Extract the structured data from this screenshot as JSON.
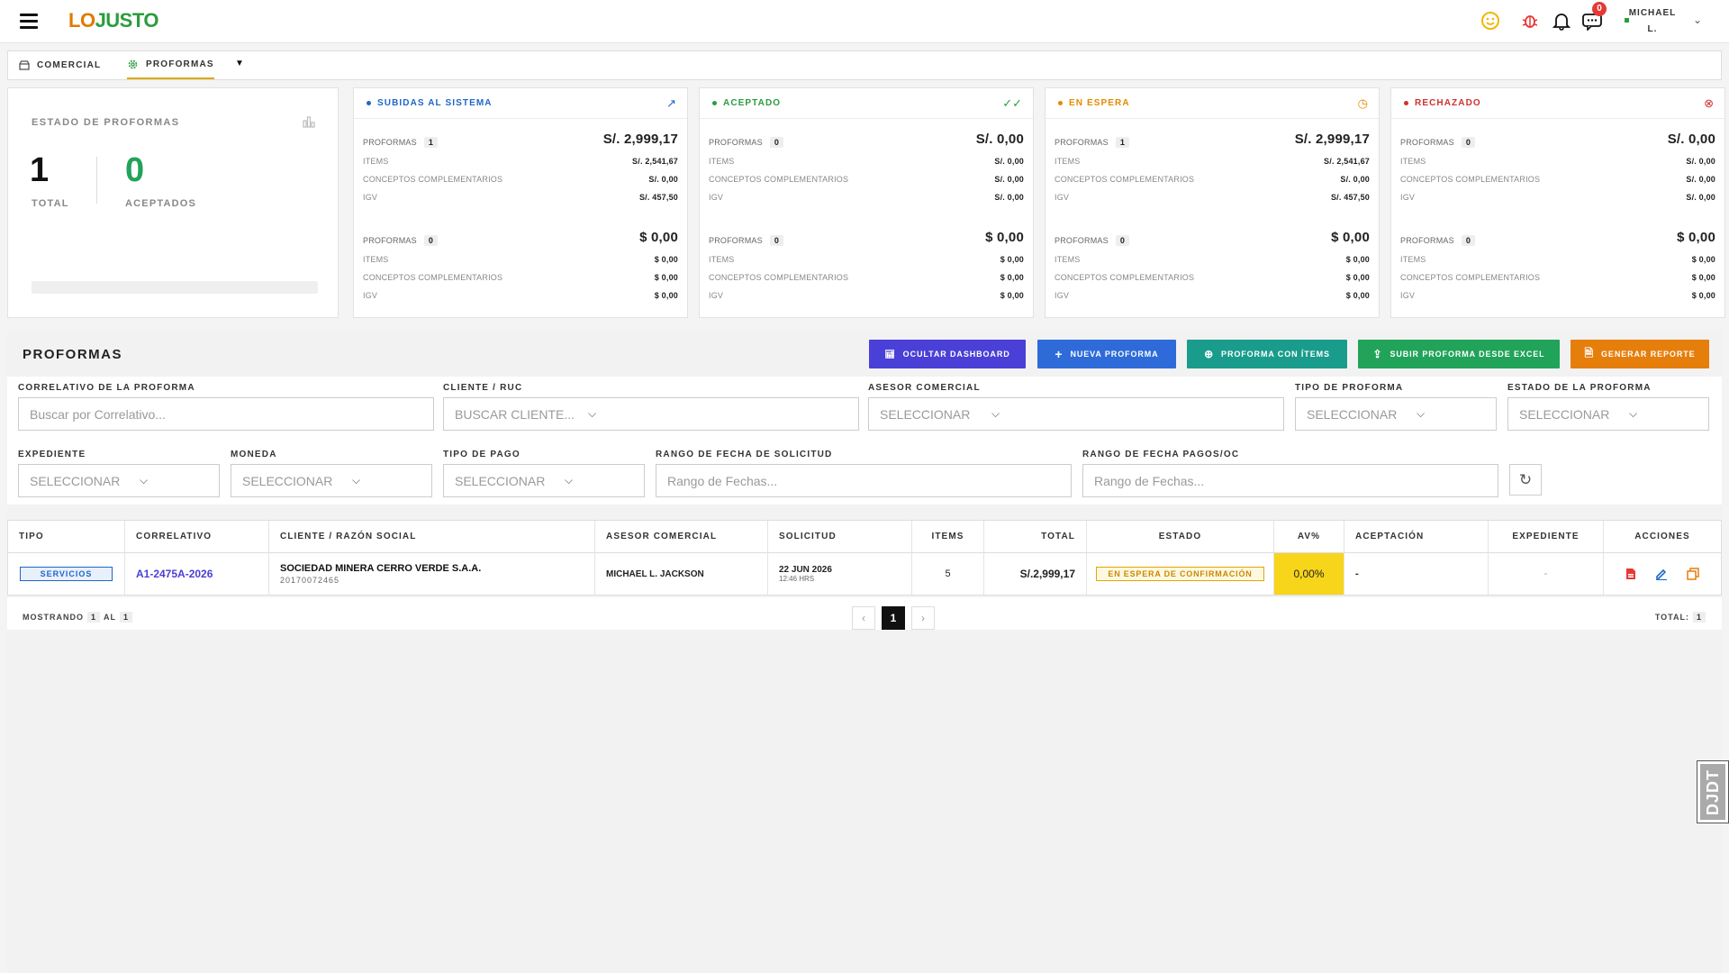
{
  "header": {
    "logo_part1": "LO",
    "logo_part2": "JUSTO",
    "notification_count": "0",
    "user_first": "MICHAEL",
    "user_last": "L."
  },
  "breadcrumb": {
    "item1": "COMERCIAL",
    "item2": "PROFORMAS"
  },
  "summary": {
    "title": "ESTADO DE PROFORMAS",
    "total_value": "1",
    "total_label": "TOTAL",
    "accepted_value": "0",
    "accepted_label": "ACEPTADOS"
  },
  "status_cards": [
    {
      "title": "SUBIDAS AL SISTEMA",
      "color": "#1e66c8",
      "soles": {
        "proformas_label": "PROFORMAS",
        "count": "1",
        "total": "S/. 2,999,17",
        "items_label": "ITEMS",
        "items": "S/. 2,541,67",
        "conceptos_label": "CONCEPTOS COMPLEMENTARIOS",
        "conceptos": "S/. 0,00",
        "igv_label": "IGV",
        "igv": "S/. 457,50"
      },
      "dolares": {
        "proformas_label": "PROFORMAS",
        "count": "0",
        "total": "$ 0,00",
        "items_label": "ITEMS",
        "items": "$ 0,00",
        "conceptos_label": "CONCEPTOS COMPLEMENTARIOS",
        "conceptos": "$ 0,00",
        "igv_label": "IGV",
        "igv": "$ 0,00"
      }
    },
    {
      "title": "ACEPTADO",
      "color": "#2a9d3d",
      "soles": {
        "proformas_label": "PROFORMAS",
        "count": "0",
        "total": "S/. 0,00",
        "items_label": "ITEMS",
        "items": "S/. 0,00",
        "conceptos_label": "CONCEPTOS COMPLEMENTARIOS",
        "conceptos": "S/. 0,00",
        "igv_label": "IGV",
        "igv": "S/. 0,00"
      },
      "dolares": {
        "proformas_label": "PROFORMAS",
        "count": "0",
        "total": "$ 0,00",
        "items_label": "ITEMS",
        "items": "$ 0,00",
        "conceptos_label": "CONCEPTOS COMPLEMENTARIOS",
        "conceptos": "$ 0,00",
        "igv_label": "IGV",
        "igv": "$ 0,00"
      }
    },
    {
      "title": "EN ESPERA",
      "color": "#e68a00",
      "soles": {
        "proformas_label": "PROFORMAS",
        "count": "1",
        "total": "S/. 2,999,17",
        "items_label": "ITEMS",
        "items": "S/. 2,541,67",
        "conceptos_label": "CONCEPTOS COMPLEMENTARIOS",
        "conceptos": "S/. 0,00",
        "igv_label": "IGV",
        "igv": "S/. 457,50"
      },
      "dolares": {
        "proformas_label": "PROFORMAS",
        "count": "0",
        "total": "$ 0,00",
        "items_label": "ITEMS",
        "items": "$ 0,00",
        "conceptos_label": "CONCEPTOS COMPLEMENTARIOS",
        "conceptos": "$ 0,00",
        "igv_label": "IGV",
        "igv": "$ 0,00"
      }
    },
    {
      "title": "RECHAZADO",
      "color": "#d32f2f",
      "soles": {
        "proformas_label": "PROFORMAS",
        "count": "0",
        "total": "S/. 0,00",
        "items_label": "ITEMS",
        "items": "S/. 0,00",
        "conceptos_label": "CONCEPTOS COMPLEMENTARIOS",
        "conceptos": "S/. 0,00",
        "igv_label": "IGV",
        "igv": "S/. 0,00"
      },
      "dolares": {
        "proformas_label": "PROFORMAS",
        "count": "0",
        "total": "$ 0,00",
        "items_label": "ITEMS",
        "items": "$ 0,00",
        "conceptos_label": "CONCEPTOS COMPLEMENTARIOS",
        "conceptos": "$ 0,00",
        "igv_label": "IGV",
        "igv": "$ 0,00"
      }
    }
  ],
  "section": {
    "title": "PROFORMAS",
    "buttons": {
      "hide_dashboard": "OCULTAR DASHBOARD",
      "new_proforma": "NUEVA PROFORMA",
      "proforma_items": "PROFORMA CON ÍTEMS",
      "upload_excel": "SUBIR PROFORMA DESDE EXCEL",
      "report": "GENERAR REPORTE"
    },
    "colors": {
      "purple": "#4a3fd6",
      "blue": "#2e6bd9",
      "teal": "#1a9c8c",
      "green": "#21a35a",
      "orange": "#e67e0c"
    }
  },
  "filters": {
    "correlativo_label": "CORRELATIVO DE LA PROFORMA",
    "correlativo_placeholder": "Buscar por Correlativo...",
    "cliente_label": "CLIENTE / RUC",
    "cliente_value": "BUSCAR CLIENTE...",
    "asesor_label": "ASESOR COMERCIAL",
    "asesor_value": "SELECCIONAR",
    "tipo_label": "TIPO DE PROFORMA",
    "tipo_value": "SELECCIONAR",
    "estado_label": "ESTADO DE LA PROFORMA",
    "estado_value": "SELECCIONAR",
    "expediente_label": "EXPEDIENTE",
    "expediente_value": "SELECCIONAR",
    "moneda_label": "MONEDA",
    "moneda_value": "SELECCIONAR",
    "pago_label": "TIPO DE PAGO",
    "pago_value": "SELECCIONAR",
    "fecha_sol_label": "RANGO DE FECHA DE SOLICITUD",
    "fecha_sol_placeholder": "Rango de Fechas...",
    "fecha_pago_label": "RANGO DE FECHA PAGOS/OC",
    "fecha_pago_placeholder": "Rango de Fechas..."
  },
  "table": {
    "headers": [
      "TIPO",
      "CORRELATIVO",
      "CLIENTE / RAZÓN SOCIAL",
      "ASESOR COMERCIAL",
      "SOLICITUD",
      "ITEMS",
      "TOTAL",
      "ESTADO",
      "AV%",
      "ACEPTACIÓN",
      "EXPEDIENTE",
      "ACCIONES"
    ],
    "row": {
      "tipo": "SERVICIOS",
      "correlativo": "A1-2475A-2026",
      "cliente": "SOCIEDAD MINERA CERRO VERDE S.A.A.",
      "ruc": "20170072465",
      "asesor": "MICHAEL L. JACKSON",
      "fecha": "22 JUN 2026",
      "hora": "12:46 HRS",
      "items": "5",
      "total": "S/.2,999,17",
      "estado": "EN ESPERA DE CONFIRMACIÓN",
      "av": "0,00%",
      "aceptacion": "-",
      "expediente": "-"
    }
  },
  "pager": {
    "mostrando": "MOSTRANDO",
    "from": "1",
    "al": "AL",
    "to": "1",
    "prev": "‹",
    "page": "1",
    "next": "›",
    "total_label": "TOTAL:",
    "total": "1"
  },
  "djdt": "DJDT"
}
